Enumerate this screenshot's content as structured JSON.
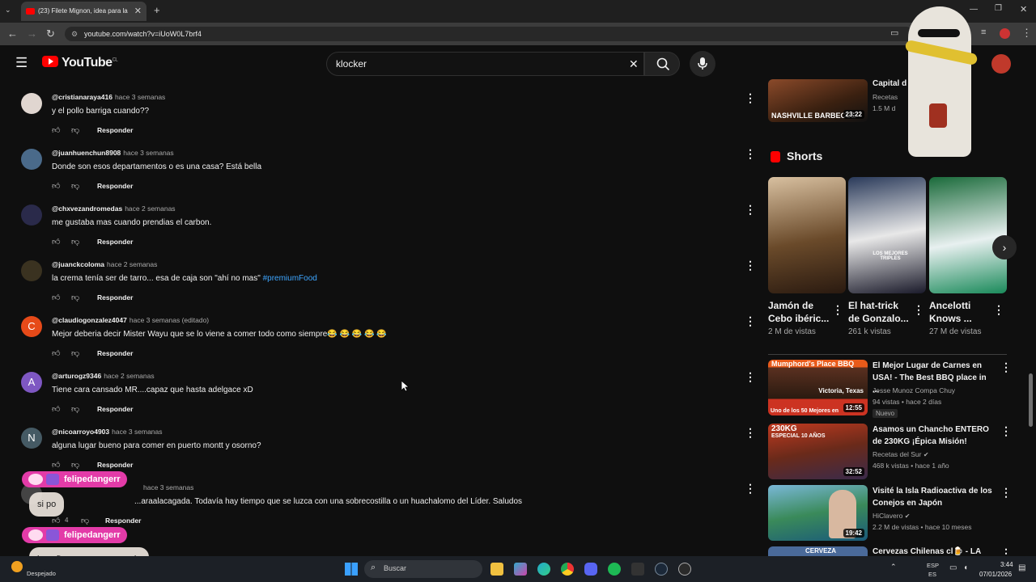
{
  "browser": {
    "tab_title": "(23) Filete Mignon, idea para la",
    "url": "youtube.com/watch?v=iUoW0L7brf4"
  },
  "youtube": {
    "logo_text": "YouTube",
    "region": "CL",
    "search_value": "klocker"
  },
  "comments": [
    {
      "user": "@cristianaraya416",
      "time": "hace 3 semanas",
      "text": "y el pollo barriga cuando??",
      "reply": "Responder",
      "avatar": ""
    },
    {
      "user": "@juanhuenchun8908",
      "time": "hace 3 semanas",
      "text": "Donde son esos departamentos o es una casa? Está bella",
      "reply": "Responder",
      "avatar": ""
    },
    {
      "user": "@chxvezandromedas",
      "time": "hace 2 semanas",
      "text": "me gustaba mas cuando prendias el carbon.",
      "reply": "Responder",
      "avatar": ""
    },
    {
      "user": "@juanckcoloma",
      "time": "hace 2 semanas",
      "text": "la crema tenía ser de tarro... esa de caja son \"ahí no mas\"",
      "tag": "#premiumFood",
      "reply": "Responder",
      "avatar": ""
    },
    {
      "user": "@claudiogonzalez4047",
      "time": "hace 3 semanas (editado)",
      "text": "Mejor deberia decir Mister Wayu que se lo viene a comer todo como siempre😂 😂 😂 😂 😂",
      "reply": "Responder",
      "avatar": "C"
    },
    {
      "user": "@arturogz9346",
      "time": "hace 2 semanas",
      "text": "Tiene cara cansado MR....capaz que hasta adelgace xD",
      "reply": "Responder",
      "avatar": "A"
    },
    {
      "user": "@nicoarroyo4903",
      "time": "hace 3 semanas",
      "text": "alguna lugar bueno para comer en puerto montt y osorno?",
      "reply": "Responder",
      "avatar": "N"
    },
    {
      "user": "",
      "time": "hace 3 semanas",
      "text": "...araalacagada. Todavía hay tiempo que se luzca con una sobrecostilla o un huachalomo del Líder. Saludos",
      "reply": "Responder",
      "likes": "4",
      "avatar": ""
    }
  ],
  "sidebar": {
    "top_video": {
      "title": "Capital d",
      "channel": "Recetas",
      "views": "1.5 M d",
      "duration": "23:22",
      "thumb_text": "NASHVILLE BARBECUE"
    },
    "shorts_heading": "Shorts",
    "shorts": [
      {
        "title": "Jamón de Cebo ibéric...",
        "views": "2 M de vistas"
      },
      {
        "title": "El hat-trick de Gonzalo...",
        "views": "261 k vistas",
        "thumb_text": "LOS MEJORES TRIPLES"
      },
      {
        "title": "Ancelotti Knows ...",
        "views": "27 M de vistas"
      }
    ],
    "videos": [
      {
        "title": "El Mejor Lugar de Carnes en USA! - The Best BBQ place in ...",
        "channel": "Jesse Munoz Compa Chuy",
        "meta": "94 vistas • hace 2 días",
        "badge": "Nuevo",
        "duration": "12:55",
        "thumb_top": "Mumphord's Place BBQ",
        "thumb_mid": "Victoria, Texas",
        "thumb_bottom": "Uno de los 50 Mejores en"
      },
      {
        "title": "Asamos un Chancho ENTERO de 230KG ¡Épica Misión!",
        "channel": "Recetas del Sur",
        "meta": "468 k vistas • hace 1 año",
        "duration": "32:52",
        "thumb_top": "230KG",
        "thumb_mid": "ESPECIAL 10 AÑOS"
      },
      {
        "title": "Visité la Isla Radioactiva de los Conejos en Japón",
        "channel": "HiClavero",
        "meta": "2.2 M de vistas • hace 10 meses",
        "duration": "19:42"
      },
      {
        "title": "Cervezas Chilenas cl🍺 - LA",
        "thumb_top": "CERVEZA"
      }
    ]
  },
  "chat": [
    {
      "name": "felipedangerr",
      "message": "si po"
    },
    {
      "name": "felipedangerr",
      "message": "la señora no se come sola"
    }
  ],
  "taskbar": {
    "weather": "Despejado",
    "search_placeholder": "Buscar",
    "lang": "ESP",
    "lang2": "ES",
    "time": "3:44",
    "date": "07/01/2026"
  },
  "colors": {
    "accent": "#ff0000",
    "link": "#3ea6ff",
    "chat_pink": "#e33ba8",
    "background": "#0f0f0f"
  }
}
